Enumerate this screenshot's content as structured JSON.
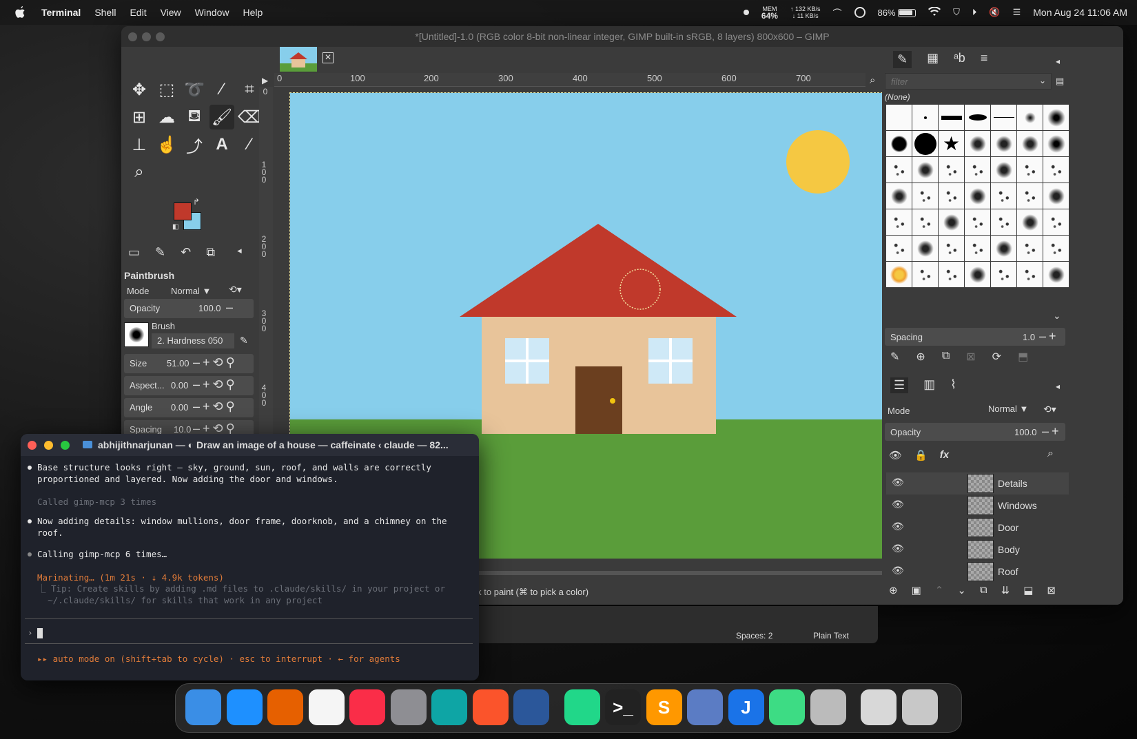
{
  "menubar": {
    "apple": "",
    "app": "Terminal",
    "items": [
      "Shell",
      "Edit",
      "View",
      "Window",
      "Help"
    ],
    "mem_label": "MEM",
    "mem_value": "64%",
    "net_up": "↑ 132 KB/s",
    "net_down": "↓ 11 KB/s",
    "battery": "86%",
    "clock": "Mon Aug 24  11:06 AM"
  },
  "gimp": {
    "title": "*[Untitled]-1.0 (RGB color 8-bit non-linear integer, GIMP built-in sRGB, 8 layers) 800x600 – GIMP",
    "tool_options": {
      "title": "Paintbrush",
      "mode_label": "Mode",
      "mode_value": "Normal",
      "opacity_label": "Opacity",
      "opacity_value": "100.0",
      "brush_label": "Brush",
      "brush_value": "2. Hardness 050",
      "size_label": "Size",
      "size_value": "51.00",
      "aspect_label": "Aspect...",
      "aspect_value": "0.00",
      "angle_label": "Angle",
      "angle_value": "0.00",
      "spacing_label": "Spacing",
      "spacing_value": "10.0"
    },
    "ruler_top": [
      "0",
      "100",
      "200",
      "300",
      "400",
      "500",
      "600",
      "700"
    ],
    "ruler_left": [
      "0",
      "100",
      "200",
      "300",
      "400"
    ],
    "status": "Click to paint (⌘ to pick a color)",
    "brushes": {
      "filter_placeholder": "filter",
      "selected": "(None)",
      "spacing_label": "Spacing",
      "spacing_value": "1.0"
    },
    "layers": {
      "mode_label": "Mode",
      "mode_value": "Normal",
      "opacity_label": "Opacity",
      "opacity_value": "100.0",
      "items": [
        {
          "name": "Details"
        },
        {
          "name": "Windows"
        },
        {
          "name": "Door"
        },
        {
          "name": "Body"
        },
        {
          "name": "Roof"
        }
      ]
    },
    "fg_color": "#c0392b",
    "bg_color": "#87ceeb"
  },
  "editor_status": {
    "spaces": "Spaces: 2",
    "lang": "Plain Text"
  },
  "terminal": {
    "title": "abhijithnarjunan — ◐ Draw an image of a house — caffeinate ‹ claude — 82...",
    "lines": [
      "Base structure looks right — sky, ground, sun, roof, and walls are correctly\nproportioned and layered. Now adding the door and windows.",
      "Called gimp-mcp 3 times",
      "Now adding details: window mullions, door frame, doorknob, and a chimney on the\nroof.",
      "Calling gimp-mcp 6 times…",
      "Marinating… (1m 21s · ↓ 4.9k tokens)",
      "⎿ Tip: Create skills by adding .md files to .claude/skills/ in your project or\n  ~/.claude/skills/ for skills that work in any project",
      "›",
      "▸▸ auto mode on (shift+tab to cycle) · esc to interrupt · ← for agents"
    ]
  },
  "dock": {
    "apps": [
      {
        "icon": "finder-icon",
        "color": "#3a8ee6"
      },
      {
        "icon": "safari-icon",
        "color": "#1e90ff"
      },
      {
        "icon": "firefox-icon",
        "color": "#e66000"
      },
      {
        "icon": "photos-icon",
        "color": "#f5f5f5"
      },
      {
        "icon": "music-icon",
        "color": "#fa2d48"
      },
      {
        "icon": "settings-icon",
        "color": "#8e8e93"
      },
      {
        "icon": "edge-icon",
        "color": "#0ea5a5"
      },
      {
        "icon": "brave-icon",
        "color": "#fb542b"
      },
      {
        "icon": "word-icon",
        "color": "#2b579a"
      },
      {
        "icon": "pycharm-icon",
        "color": "#21d789"
      },
      {
        "icon": "terminal-icon",
        "color": "#222"
      },
      {
        "icon": "sublime-icon",
        "color": "#ff9800"
      },
      {
        "icon": "db-icon",
        "color": "#5b7cc4"
      },
      {
        "icon": "jdk-icon",
        "color": "#1a73e8"
      },
      {
        "icon": "android-studio-icon",
        "color": "#3ddc84"
      },
      {
        "icon": "gimp-icon",
        "color": "#bbb"
      },
      {
        "icon": "archive-icon",
        "color": "#d8d8d8"
      },
      {
        "icon": "trash-icon",
        "color": "#c8c8c8"
      }
    ],
    "terminal_glyph": ">_",
    "sublime_glyph": "S",
    "jdk_glyph": "J"
  }
}
